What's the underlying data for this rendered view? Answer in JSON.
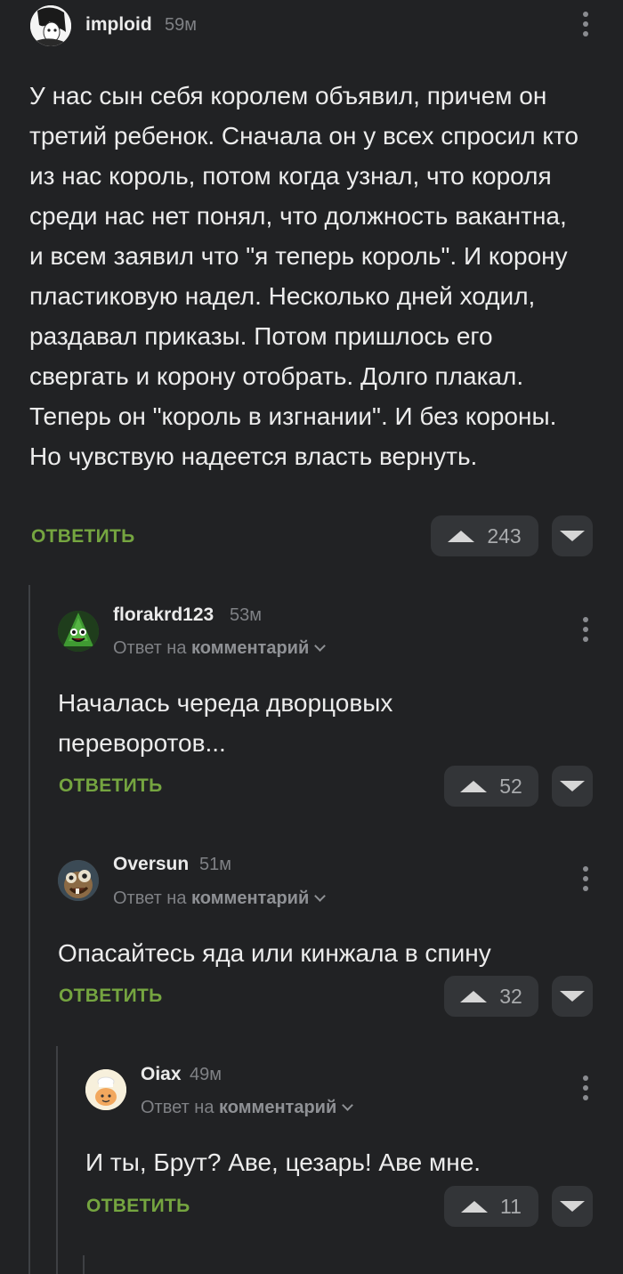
{
  "colors": {
    "background": "#212224",
    "reply_green": "#75a540",
    "vote_bg": "#333538",
    "meta_gray": "#7f8185"
  },
  "icons": {
    "more": "more-vertical-icon",
    "upvote": "upvote-triangle-icon",
    "downvote": "downvote-triangle-icon",
    "reply_expand": "chevron-down-icon"
  },
  "comments": [
    {
      "username": "imploid",
      "time": "59м",
      "text": "У нас сын себя королем объявил, причем он третий ребенок. Сначала он у всех спросил кто из нас король, потом когда узнал, что короля среди нас нет понял, что должность вакантна, и всем заявил что \"я теперь король\". И корону пластиковую надел. Несколько дней ходил, раздавал приказы. Потом пришлось его свергать и корону отобрать. Долго плакал. Теперь он \"король в изгнании\". И без короны. Но чувствую надеется власть вернуть.",
      "reply_label": "ОТВЕТИТЬ",
      "votes": "243"
    },
    {
      "username": "florakrd123",
      "time": "53м",
      "reply_prefix": "Ответ на",
      "reply_target": "комментарий",
      "text": "Началась череда дворцовых переворотов...",
      "reply_label": "ОТВЕТИТЬ",
      "votes": "52"
    },
    {
      "username": "Oversun",
      "time": "51м",
      "reply_prefix": "Ответ на",
      "reply_target": "комментарий",
      "text": "Опасайтесь яда или кинжала в спину",
      "reply_label": "ОТВЕТИТЬ",
      "votes": "32"
    },
    {
      "username": "Oiax",
      "time": "49м",
      "reply_prefix": "Ответ на",
      "reply_target": "комментарий",
      "text": "И ты, Брут? Аве, цезарь! Аве мне.",
      "reply_label": "ОТВЕТИТЬ",
      "votes": "11"
    }
  ]
}
